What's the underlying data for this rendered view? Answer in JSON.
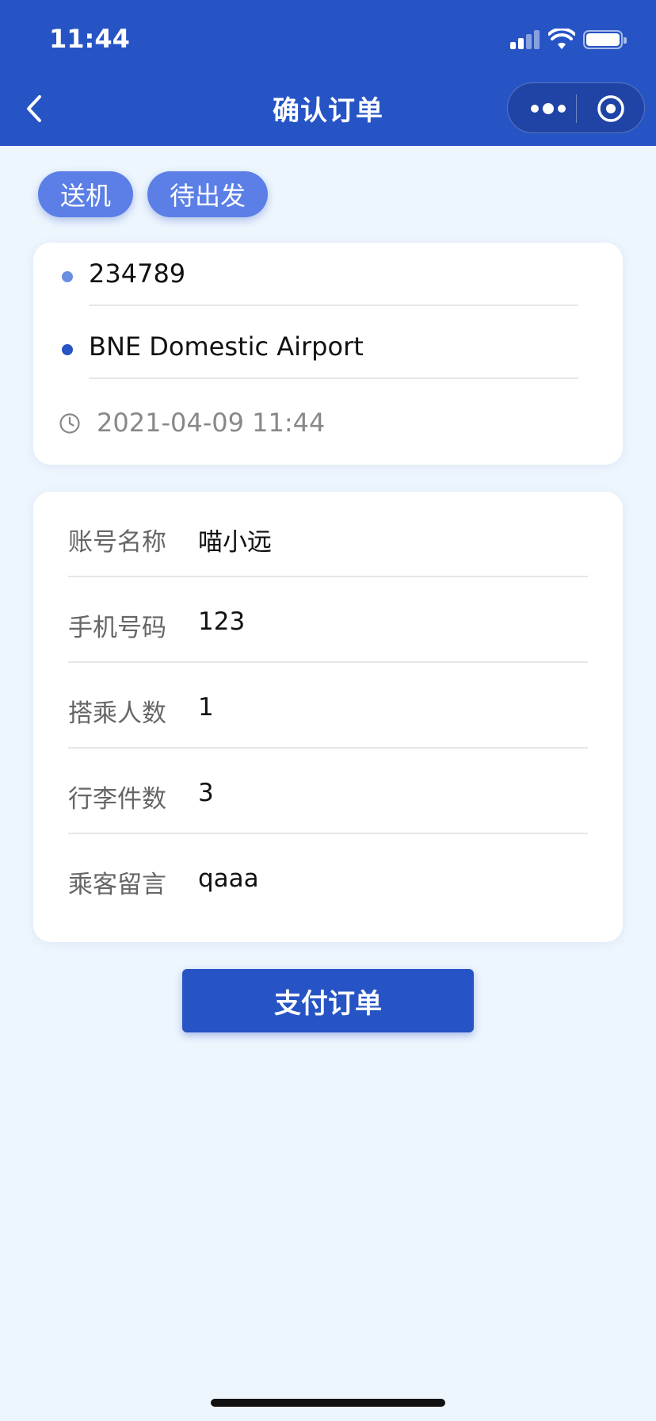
{
  "status_bar": {
    "time": "11:44"
  },
  "nav": {
    "title": "确认订单"
  },
  "tags": [
    "送机",
    "待出发"
  ],
  "route": {
    "from": "234789",
    "to": "BNE Domestic Airport",
    "datetime": "2021-04-09 11:44",
    "from_dot_color": "#6a8fe0",
    "to_dot_color": "#2754c5"
  },
  "info": [
    {
      "label": "账号名称",
      "value": "喵小远"
    },
    {
      "label": "手机号码",
      "value": "123"
    },
    {
      "label": "搭乘人数",
      "value": "1"
    },
    {
      "label": "行李件数",
      "value": "3"
    },
    {
      "label": "乘客留言",
      "value": "qaaa"
    }
  ],
  "actions": {
    "pay_label": "支付订单"
  },
  "colors": {
    "primary": "#2754c5",
    "tag": "#5b7fe6",
    "background": "#edf5fd"
  }
}
